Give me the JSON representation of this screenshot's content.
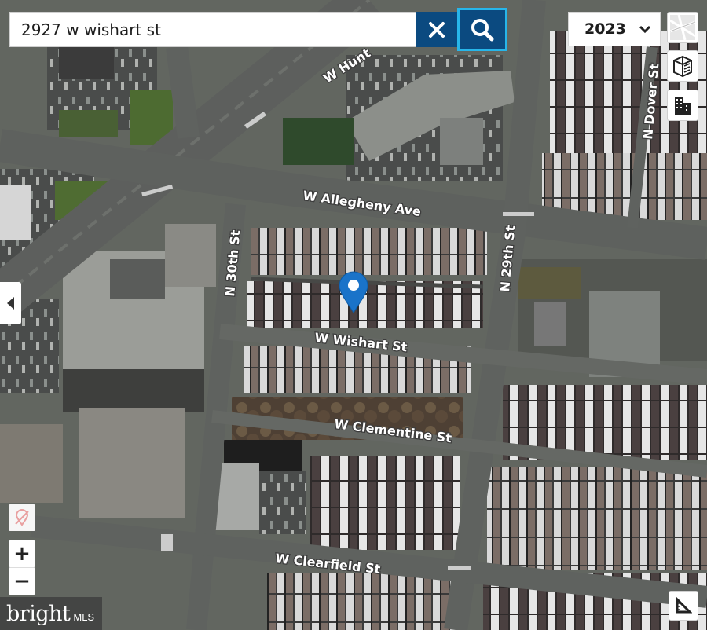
{
  "search": {
    "value": "2927 w wishart st"
  },
  "year_select": {
    "value": "2023"
  },
  "streets": [
    {
      "key": "hunting_park",
      "label": "W Hunt"
    },
    {
      "key": "allegheny",
      "label": "W Allegheny Ave"
    },
    {
      "key": "n29th",
      "label": "N 29th St"
    },
    {
      "key": "n30th",
      "label": "N 30th St"
    },
    {
      "key": "wishart",
      "label": "W Wishart St"
    },
    {
      "key": "clementine",
      "label": "W Clementine St"
    },
    {
      "key": "clearfield",
      "label": "W Clearfield St"
    },
    {
      "key": "dover",
      "label": "N Dover St"
    }
  ],
  "icons": {
    "clear": "close-icon",
    "search": "search-icon",
    "dropdown": "chevron-down-icon",
    "map_type": "map-thumbnail-icon",
    "3d": "3d-building-icon",
    "buildings": "buildings-icon",
    "sidebar": "chevron-left-icon",
    "location": "no-location-icon",
    "measure": "ruler-icon",
    "marker": "map-pin-icon"
  },
  "zoom_controls": {
    "zoom_in": "+",
    "zoom_out": "−"
  },
  "logo": {
    "brand": "bright",
    "suffix": "MLS"
  },
  "colors": {
    "search_button": "#0b4a80",
    "search_button_border": "#27b6ea",
    "marker": "#1a73c9"
  }
}
